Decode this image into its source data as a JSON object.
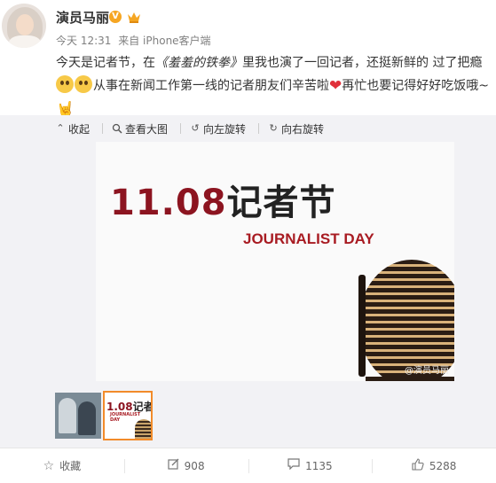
{
  "post": {
    "username": "演员马丽",
    "verified_badge": "V",
    "time": "今天 12:31",
    "source": "来自 iPhone客户端",
    "text_part1": "今天是记者节，在",
    "text_title": "《羞羞的铁拳》",
    "text_part2": "里我也演了一回记者，还挺新鲜的 过了把瘾",
    "text_part3": "从事在新闻工作第一线的记者朋友们辛苦啦",
    "text_part4": "再忙也要记得好好吃饭哦~"
  },
  "toolbar": {
    "collapse": "收起",
    "view_large": "查看大图",
    "rotate_left": "向左旋转",
    "rotate_right": "向右旋转"
  },
  "image": {
    "headline_num": "11.08",
    "headline_cn": "记者节",
    "subtitle": "JOURNALIST DAY",
    "watermark": "@演员马丽"
  },
  "thumb": {
    "num": "1.08",
    "cn": "记者节",
    "sub": "JOURNALIST DAY"
  },
  "footer": {
    "favorite": "收藏",
    "repost": "908",
    "comment": "1135",
    "like": "5288"
  },
  "colors": {
    "headline_red": "#8c1420",
    "thumb_selected": "#f28b2a",
    "verified_orange": "#f6a623"
  },
  "icons": {
    "collapse": "arrow-up-icon",
    "view_large": "magnifier-icon",
    "rotate_left": "rotate-left-icon",
    "rotate_right": "rotate-right-icon",
    "favorite": "star-icon",
    "repost": "repost-icon",
    "comment": "comment-icon",
    "like": "thumbs-up-icon"
  }
}
